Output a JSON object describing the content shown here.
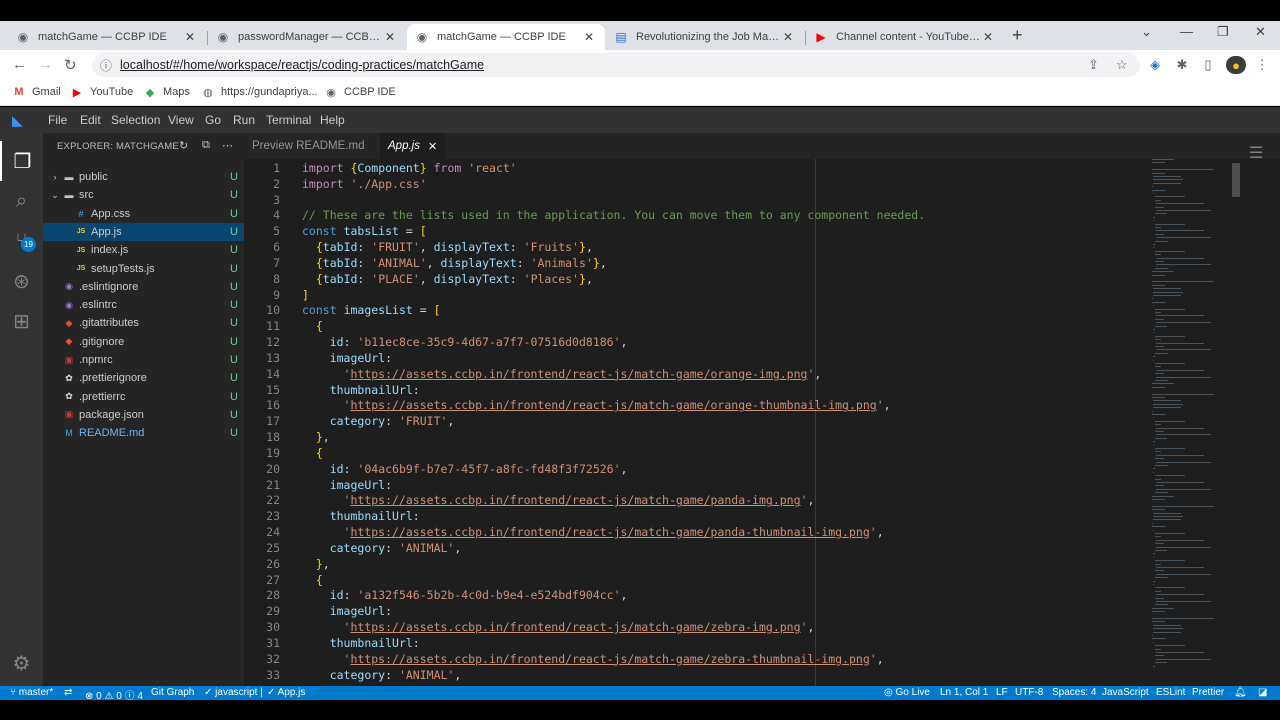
{
  "browser": {
    "tabs": [
      {
        "title": "matchGame — CCBP IDE",
        "icon": "ccbp-icon"
      },
      {
        "title": "passwordManager — CCBP IDE",
        "icon": "ccbp-icon"
      },
      {
        "title": "matchGame — CCBP IDE",
        "icon": "ccbp-icon",
        "active": true
      },
      {
        "title": "Revolutionizing the Job Market |",
        "icon": "article-icon"
      },
      {
        "title": "Channel content - YouTube Studi",
        "icon": "youtube-icon"
      }
    ],
    "url": "localhost/#/home/workspace/reactjs/coding-practices/matchGame",
    "bookmarks": [
      {
        "label": "Gmail",
        "icon": "gmail-icon"
      },
      {
        "label": "YouTube",
        "icon": "youtube-icon"
      },
      {
        "label": "Maps",
        "icon": "maps-icon"
      },
      {
        "label": "https://gundapriya...",
        "icon": "globe-icon"
      },
      {
        "label": "CCBP IDE",
        "icon": "ccbp-icon"
      }
    ]
  },
  "menu": [
    "File",
    "Edit",
    "Selection",
    "View",
    "Go",
    "Run",
    "Terminal",
    "Help"
  ],
  "activity": {
    "scm_badge": "19"
  },
  "explorer": {
    "title": "EXPLORER: MATCHGAME",
    "items": [
      {
        "name": "public",
        "type": "folder",
        "depth": 0,
        "status": "U",
        "open": false
      },
      {
        "name": "src",
        "type": "folder",
        "depth": 0,
        "status": "U",
        "open": true
      },
      {
        "name": "App.css",
        "type": "css",
        "depth": 1,
        "status": "U"
      },
      {
        "name": "App.js",
        "type": "js",
        "depth": 1,
        "status": "U",
        "selected": true
      },
      {
        "name": "index.js",
        "type": "js",
        "depth": 1,
        "status": "U"
      },
      {
        "name": "setupTests.js",
        "type": "js",
        "depth": 1,
        "status": "U"
      },
      {
        "name": ".eslintignore",
        "type": "eslint",
        "depth": 0,
        "status": "U"
      },
      {
        "name": ".eslintrc",
        "type": "eslint",
        "depth": 0,
        "status": "U"
      },
      {
        "name": ".gitattributes",
        "type": "git",
        "depth": 0,
        "status": "U"
      },
      {
        "name": ".gitignore",
        "type": "git",
        "depth": 0,
        "status": "U"
      },
      {
        "name": ".npmrc",
        "type": "npm",
        "depth": 0,
        "status": "U"
      },
      {
        "name": ".prettierignore",
        "type": "prettier",
        "depth": 0,
        "status": "U"
      },
      {
        "name": ".prettierrc",
        "type": "prettier",
        "depth": 0,
        "status": "U"
      },
      {
        "name": "package.json",
        "type": "npm",
        "depth": 0,
        "status": "U"
      },
      {
        "name": "README.md",
        "type": "md",
        "depth": 0,
        "status": "U"
      }
    ]
  },
  "editor_tabs": [
    {
      "label": "Preview README.md",
      "active": false
    },
    {
      "label": "App.js",
      "active": true
    }
  ],
  "code_lines": [
    "import {Component} from 'react'",
    "import './App.css'",
    "",
    "// These are the lists used in the application. You can move them to any component needed.",
    "const tabsList = [",
    "  {tabId: 'FRUIT', displayText: 'Fruits'},",
    "  {tabId: 'ANIMAL', displayText: 'Animals'},",
    "  {tabId: 'PLACE', displayText: 'Places'},",
    "]",
    "const imagesList = [",
    "  {",
    "    id: 'b11ec8ce-35c9-4d67-a7f7-07516d0d8186',",
    "    imageUrl:",
    "      'https://assets.ccbp.in/frontend/react-js/match-game/orange-img.png',",
    "    thumbnailUrl:",
    "      'https://assets.ccbp.in/frontend/react-js/match-game/orange-thumbnail-img.png',",
    "    category: 'FRUIT',",
    "  },",
    "  {",
    "    id: '04ac6b9f-b7e7-45f7-a8fc-fd48f3f72526',",
    "    imageUrl:",
    "      'https://assets.ccbp.in/frontend/react-js/match-game/panda-img.png',",
    "    thumbnailUrl:",
    "      'https://assets.ccbp.in/frontend/react-js/match-game/panda-thumbnail-img.png',",
    "    category: 'ANIMAL',",
    "  },",
    "  {",
    "    id: 'a132f546-5b2b-4c0d-b9e4-e524bdf904cc',",
    "    imageUrl:",
    "      'https://assets.ccbp.in/frontend/react-js/match-game/zebra-img.png',",
    "    thumbnailUrl:",
    "      'https://assets.ccbp.in/frontend/react-js/match-game/zebra-thumbnail-img.png',",
    "    category: 'ANIMAL',"
  ],
  "status": {
    "branch": "master*",
    "problems": "0",
    "warnings": "0",
    "info": "4",
    "git_graph": "Git Graph",
    "language_check": "javascript |",
    "file_check": "App.js",
    "go_live": "Go Live",
    "position": "Ln 1, Col 1",
    "eol": "LF",
    "encoding": "UTF-8",
    "spaces": "Spaces: 4",
    "language": "JavaScript",
    "eslint": "ESLint",
    "prettier": "Prettier"
  },
  "colors": {
    "accent": "#007acc",
    "status_text": "#73c991",
    "selection": "#094771"
  }
}
